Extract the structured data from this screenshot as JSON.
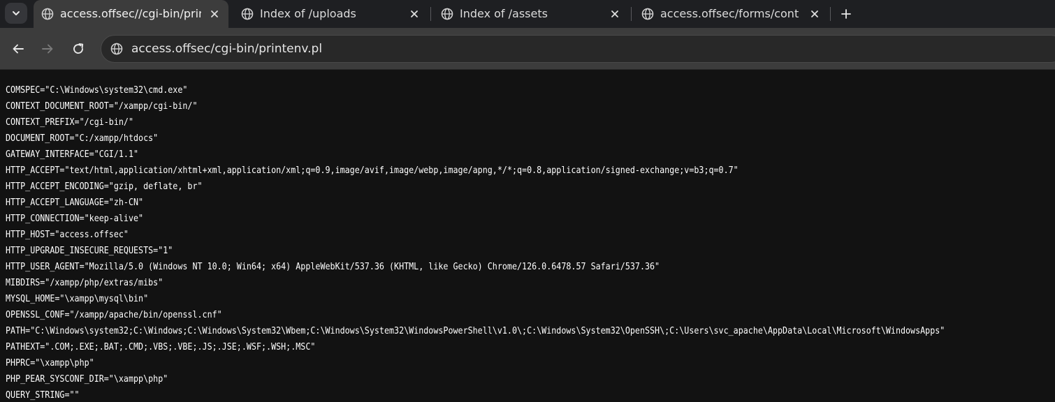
{
  "tabs": [
    {
      "title": "access.offsec//cgi-bin/printenv.pl",
      "active": true
    },
    {
      "title": "Index of /uploads",
      "active": false
    },
    {
      "title": "Index of /assets",
      "active": false
    },
    {
      "title": "access.offsec/forms/contact.php",
      "active": false
    }
  ],
  "address_bar": {
    "url": "access.offsec/cgi-bin/printenv.pl"
  },
  "icons": {
    "tab_search": "chevron-down-icon",
    "favicon": "globe-icon",
    "close": "close-icon",
    "new_tab": "plus-icon",
    "back": "back-arrow-icon",
    "forward": "forward-arrow-icon",
    "reload": "reload-icon",
    "site_info": "site-info-icon"
  },
  "colors": {
    "background": "#121212",
    "text": "#ffffff",
    "toolbar": "#3c3c3c",
    "tabstrip": "#1e1f22"
  },
  "env_lines": [
    "COMSPEC=\"C:\\Windows\\system32\\cmd.exe\"",
    "CONTEXT_DOCUMENT_ROOT=\"/xampp/cgi-bin/\"",
    "CONTEXT_PREFIX=\"/cgi-bin/\"",
    "DOCUMENT_ROOT=\"C:/xampp/htdocs\"",
    "GATEWAY_INTERFACE=\"CGI/1.1\"",
    "HTTP_ACCEPT=\"text/html,application/xhtml+xml,application/xml;q=0.9,image/avif,image/webp,image/apng,*/*;q=0.8,application/signed-exchange;v=b3;q=0.7\"",
    "HTTP_ACCEPT_ENCODING=\"gzip, deflate, br\"",
    "HTTP_ACCEPT_LANGUAGE=\"zh-CN\"",
    "HTTP_CONNECTION=\"keep-alive\"",
    "HTTP_HOST=\"access.offsec\"",
    "HTTP_UPGRADE_INSECURE_REQUESTS=\"1\"",
    "HTTP_USER_AGENT=\"Mozilla/5.0 (Windows NT 10.0; Win64; x64) AppleWebKit/537.36 (KHTML, like Gecko) Chrome/126.0.6478.57 Safari/537.36\"",
    "MIBDIRS=\"/xampp/php/extras/mibs\"",
    "MYSQL_HOME=\"\\xampp\\mysql\\bin\"",
    "OPENSSL_CONF=\"/xampp/apache/bin/openssl.cnf\"",
    "PATH=\"C:\\Windows\\system32;C:\\Windows;C:\\Windows\\System32\\Wbem;C:\\Windows\\System32\\WindowsPowerShell\\v1.0\\;C:\\Windows\\System32\\OpenSSH\\;C:\\Users\\svc_apache\\AppData\\Local\\Microsoft\\WindowsApps\"",
    "PATHEXT=\".COM;.EXE;.BAT;.CMD;.VBS;.VBE;.JS;.JSE;.WSF;.WSH;.MSC\"",
    "PHPRC=\"\\xampp\\php\"",
    "PHP_PEAR_SYSCONF_DIR=\"\\xampp\\php\"",
    "QUERY_STRING=\"\""
  ]
}
